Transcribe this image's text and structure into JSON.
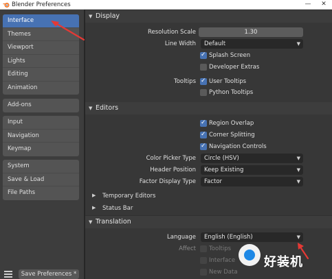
{
  "window": {
    "title": "Blender Preferences",
    "controls": {
      "minimize": "—",
      "close": "✕"
    }
  },
  "sidebar": {
    "groups": [
      {
        "items": [
          {
            "label": "Interface",
            "active": true
          },
          {
            "label": "Themes"
          },
          {
            "label": "Viewport"
          },
          {
            "label": "Lights"
          },
          {
            "label": "Editing"
          },
          {
            "label": "Animation"
          }
        ]
      },
      {
        "items": [
          {
            "label": "Add-ons"
          }
        ]
      },
      {
        "items": [
          {
            "label": "Input"
          },
          {
            "label": "Navigation"
          },
          {
            "label": "Keymap"
          }
        ]
      },
      {
        "items": [
          {
            "label": "System"
          },
          {
            "label": "Save & Load"
          },
          {
            "label": "File Paths"
          }
        ]
      }
    ],
    "save_button": "Save Preferences *"
  },
  "display": {
    "header": "Display",
    "resolution_scale_label": "Resolution Scale",
    "resolution_scale_value": "1.30",
    "line_width_label": "Line Width",
    "line_width_value": "Default",
    "splash_screen": {
      "label": "Splash Screen",
      "checked": true
    },
    "developer_extras": {
      "label": "Developer Extras",
      "checked": false
    },
    "tooltips_label": "Tooltips",
    "user_tooltips": {
      "label": "User Tooltips",
      "checked": true
    },
    "python_tooltips": {
      "label": "Python Tooltips",
      "checked": false
    }
  },
  "editors": {
    "header": "Editors",
    "region_overlap": {
      "label": "Region Overlap",
      "checked": true
    },
    "corner_splitting": {
      "label": "Corner Splitting",
      "checked": true
    },
    "navigation_controls": {
      "label": "Navigation Controls",
      "checked": true
    },
    "color_picker_type_label": "Color Picker Type",
    "color_picker_type_value": "Circle (HSV)",
    "header_position_label": "Header Position",
    "header_position_value": "Keep Existing",
    "factor_display_type_label": "Factor Display Type",
    "factor_display_type_value": "Factor",
    "temporary_editors": "Temporary Editors",
    "status_bar": "Status Bar"
  },
  "translation": {
    "header": "Translation",
    "language_label": "Language",
    "language_value": "English (English)",
    "affect_label": "Affect",
    "tooltips": {
      "label": "Tooltips",
      "checked": false
    },
    "interface": {
      "label": "Interface",
      "checked": false
    },
    "new_data": {
      "label": "New Data",
      "checked": false
    }
  },
  "watermark": {
    "text": "好装机"
  },
  "colors": {
    "accent": "#4772b3",
    "annotation_arrow": "#e53935"
  }
}
